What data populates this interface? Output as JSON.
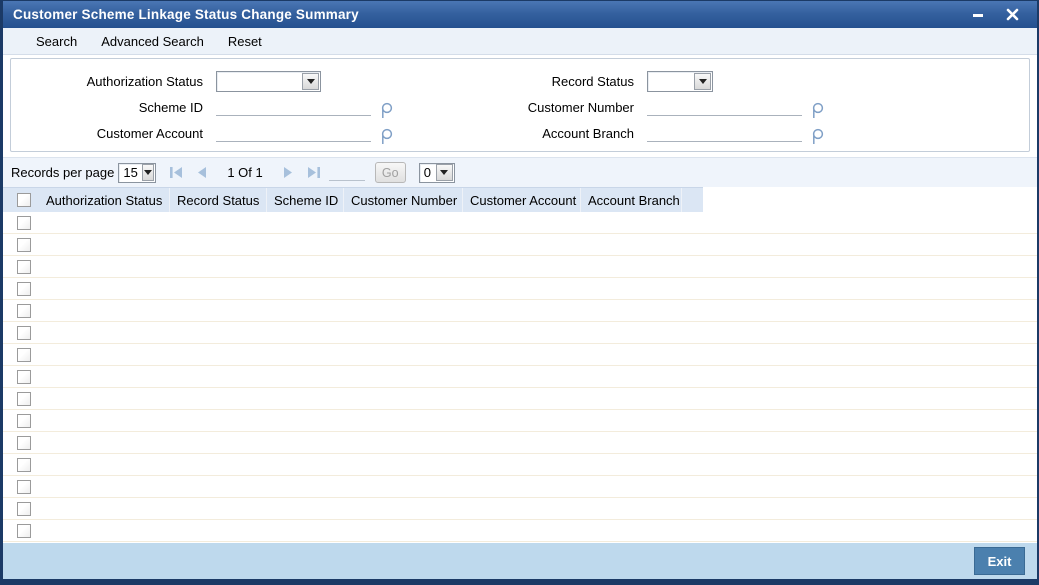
{
  "window": {
    "title": "Customer Scheme Linkage Status Change Summary",
    "controls": {
      "minimize": "minimize",
      "close": "close"
    }
  },
  "toolbar": {
    "items": [
      {
        "label": "Search"
      },
      {
        "label": "Advanced Search"
      },
      {
        "label": "Reset"
      }
    ]
  },
  "form": {
    "fields": [
      {
        "label": "Authorization Status",
        "type": "select",
        "value": ""
      },
      {
        "label": "Record Status",
        "type": "select",
        "value": ""
      },
      {
        "label": "Scheme ID",
        "type": "lookup",
        "value": ""
      },
      {
        "label": "Customer Number",
        "type": "lookup",
        "value": ""
      },
      {
        "label": "Customer Account",
        "type": "lookup",
        "value": ""
      },
      {
        "label": "Account Branch",
        "type": "lookup",
        "value": ""
      }
    ]
  },
  "pagination": {
    "records_per_page_label": "Records per page",
    "records_per_page_value": "15",
    "page_text": "1 Of 1",
    "goto_value": "",
    "go_label": "Go",
    "page_select_value": "0"
  },
  "table": {
    "columns": [
      "Authorization Status",
      "Record Status",
      "Scheme ID",
      "Customer Number",
      "Customer Account",
      "Account Branch"
    ],
    "row_count": 15,
    "rows": []
  },
  "footer": {
    "exit_label": "Exit"
  },
  "colors": {
    "titlebar_top": "#4a76b4",
    "titlebar_bottom": "#24508f",
    "window_border": "#1b3a66",
    "toolbar_bg": "#ecf2f9",
    "header_bg": "#dbe6f4",
    "row_separator": "#f3ecdc",
    "footer_bg": "#bed9ed",
    "exit_button_bg": "#4b80ae",
    "pagination_icon": "#a7c0dc",
    "lookup_icon": "#7f9fc6"
  }
}
